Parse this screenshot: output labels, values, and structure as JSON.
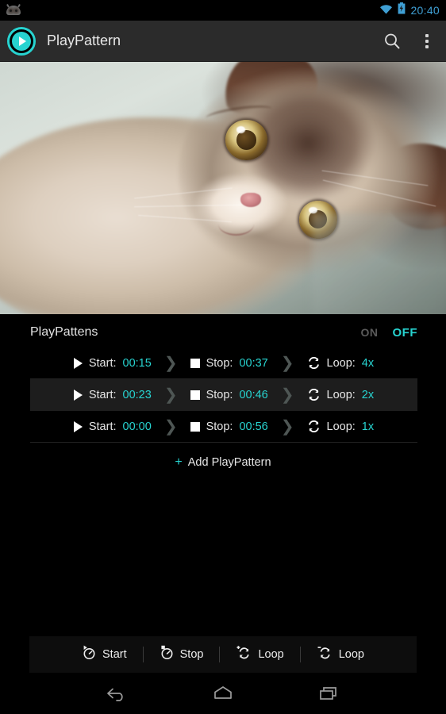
{
  "statusbar": {
    "notification_icon": "android-head-icon",
    "wifi_icon": "wifi-icon",
    "battery_icon": "battery-charging-icon",
    "time": "20:40",
    "accent_color": "#3F9FD4"
  },
  "actionbar": {
    "app_icon": "play-circle-icon",
    "title": "PlayPattern",
    "search_icon": "search-icon",
    "overflow_icon": "overflow-menu-icon",
    "background": "#2B2B2B"
  },
  "video": {
    "name": "video-preview",
    "content_description": "Cat video frame"
  },
  "panel": {
    "title": "PlayPattens",
    "toggle": {
      "on_label": "ON",
      "off_label": "OFF",
      "selected": "OFF",
      "on_color": "#5A5A5A",
      "off_color": "#27D3D0"
    },
    "rows": [
      {
        "start_label": "Start:",
        "start_value": "00:15",
        "stop_label": "Stop:",
        "stop_value": "00:37",
        "loop_label": "Loop:",
        "loop_value": "4x",
        "selected": false
      },
      {
        "start_label": "Start:",
        "start_value": "00:23",
        "stop_label": "Stop:",
        "stop_value": "00:46",
        "loop_label": "Loop:",
        "loop_value": "2x",
        "selected": true
      },
      {
        "start_label": "Start:",
        "start_value": "00:00",
        "stop_label": "Stop:",
        "stop_value": "00:56",
        "loop_label": "Loop:",
        "loop_value": "1x",
        "selected": false
      }
    ],
    "add": {
      "plus": "+",
      "label": "Add PlayPattern"
    },
    "accent_color": "#27D3D0"
  },
  "toolbar": {
    "items": [
      {
        "icon": "timer-start-icon",
        "label": "Start"
      },
      {
        "icon": "timer-stop-icon",
        "label": "Stop"
      },
      {
        "icon": "loop-plus-icon",
        "label": "Loop"
      },
      {
        "icon": "loop-minus-icon",
        "label": "Loop"
      }
    ]
  },
  "navbar": {
    "back_icon": "back-icon",
    "home_icon": "home-icon",
    "recents_icon": "recents-icon"
  }
}
